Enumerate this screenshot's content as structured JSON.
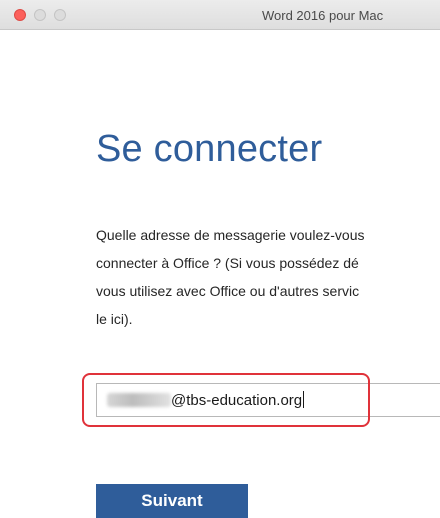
{
  "window": {
    "title": "Word 2016 pour Mac",
    "controls": [
      "close-icon",
      "minimize-icon",
      "maximize-icon"
    ]
  },
  "signin": {
    "heading": "Se connecter",
    "prompt_lines": [
      "Quelle adresse de messagerie voulez-vous",
      "connecter à Office ? (Si vous possédez dé",
      "vous utilisez avec Office ou d'autres servic",
      "le ici)."
    ],
    "email_value": "@tbs-education.org",
    "next_label": "Suivant"
  },
  "colors": {
    "accent": "#2f5d9a",
    "highlight": "#e0323a",
    "close": "#fc605b"
  }
}
